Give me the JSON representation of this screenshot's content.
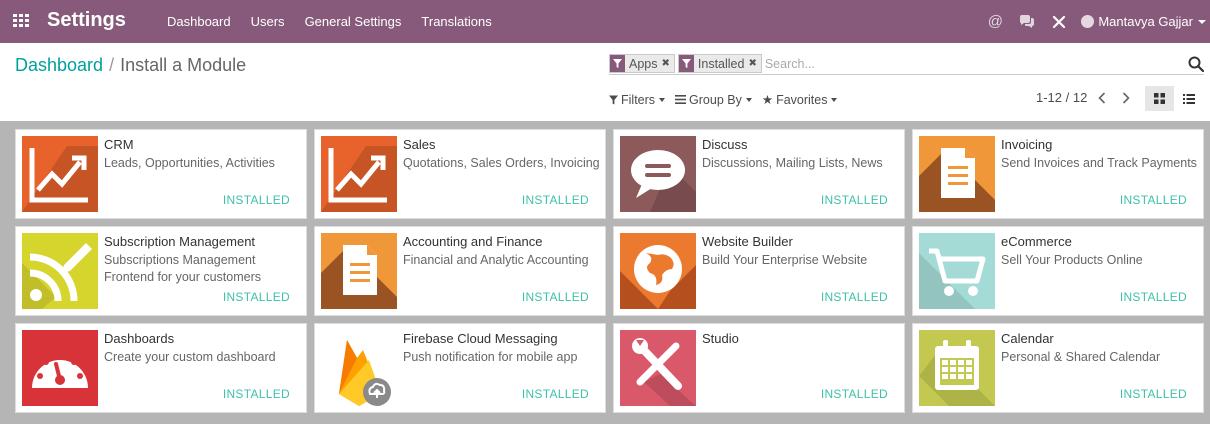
{
  "app": {
    "title": "Settings",
    "menu": [
      "Dashboard",
      "Users",
      "General Settings",
      "Translations"
    ],
    "user": "Mantavya Gajjar"
  },
  "breadcrumb": {
    "parent": "Dashboard",
    "separator": "/",
    "current": "Install a Module"
  },
  "search": {
    "facets": [
      "Apps",
      "Installed"
    ],
    "placeholder": "Search..."
  },
  "filters": {
    "filters_label": "Filters",
    "groupby_label": "Group By",
    "favorites_label": "Favorites"
  },
  "pager": {
    "value": "1-12 / 12"
  },
  "modules": [
    {
      "name": "CRM",
      "summary": [
        "Leads, Opportunities, Activities"
      ],
      "status": "INSTALLED",
      "icon": "chart-up-icon",
      "color": "#e8622b"
    },
    {
      "name": "Sales",
      "summary": [
        "Quotations, Sales Orders, Invoicing"
      ],
      "status": "INSTALLED",
      "icon": "chart-up-icon",
      "color": "#e8622b"
    },
    {
      "name": "Discuss",
      "summary": [
        "Discussions, Mailing Lists, News"
      ],
      "status": "INSTALLED",
      "icon": "chat-bubble-icon",
      "color": "#8d5a5c"
    },
    {
      "name": "Invoicing",
      "summary": [
        "Send Invoices and Track Payments"
      ],
      "status": "INSTALLED",
      "icon": "document-icon",
      "color": "#f0973a"
    },
    {
      "name": "Subscription Management",
      "summary": [
        "Subscriptions Management",
        "Frontend for your customers"
      ],
      "status": "INSTALLED",
      "icon": "rss-pencil-icon",
      "color": "#d6d52e"
    },
    {
      "name": "Accounting and Finance",
      "summary": [
        "Financial and Analytic Accounting"
      ],
      "status": "INSTALLED",
      "icon": "document-icon",
      "color": "#f0973a"
    },
    {
      "name": "Website Builder",
      "summary": [
        "Build Your Enterprise Website"
      ],
      "status": "INSTALLED",
      "icon": "globe-icon",
      "color": "#ec7a2e"
    },
    {
      "name": "eCommerce",
      "summary": [
        "Sell Your Products Online"
      ],
      "status": "INSTALLED",
      "icon": "cart-icon",
      "color": "#a4dbd6"
    },
    {
      "name": "Dashboards",
      "summary": [
        "Create your custom dashboard"
      ],
      "status": "INSTALLED",
      "icon": "gauge-icon",
      "color": "#d9333a"
    },
    {
      "name": "Firebase Cloud Messaging",
      "summary": [
        "Push notification for mobile app"
      ],
      "status": "INSTALLED",
      "icon": "firebase-icon",
      "color": "#ffffff"
    },
    {
      "name": "Studio",
      "summary": [
        ""
      ],
      "status": "INSTALLED",
      "icon": "tools-icon",
      "color": "#d9596a"
    },
    {
      "name": "Calendar",
      "summary": [
        "Personal & Shared Calendar"
      ],
      "status": "INSTALLED",
      "icon": "calendar-icon",
      "color": "#c2c850"
    }
  ]
}
